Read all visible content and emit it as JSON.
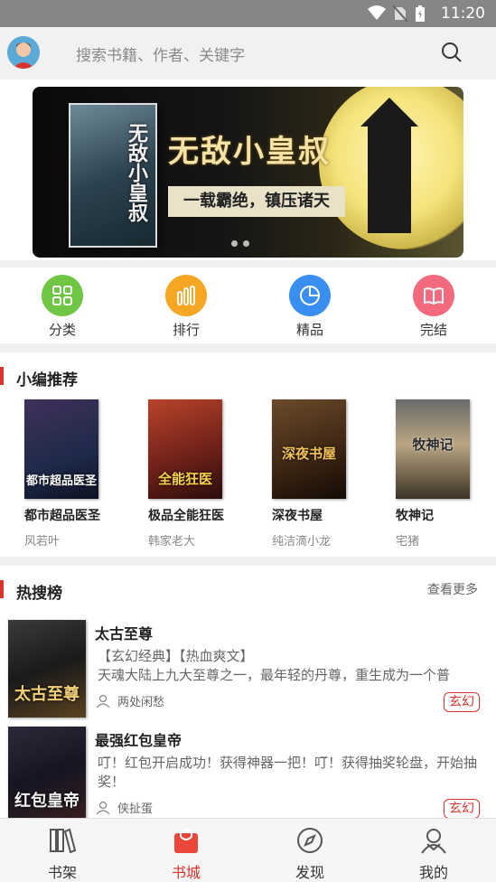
{
  "status_bar": {
    "time": "11:20"
  },
  "search": {
    "placeholder": "搜索书籍、作者、关键字"
  },
  "banner": {
    "title": "无敌小皇叔",
    "subtitle": "一载霸绝，镇压诸天",
    "cover_text": "无敌小皇叔"
  },
  "categories": [
    {
      "label": "分类",
      "color": "#6fc645",
      "icon": "grid-icon"
    },
    {
      "label": "排行",
      "color": "#f5a623",
      "icon": "bars-icon"
    },
    {
      "label": "精品",
      "color": "#3a8ef0",
      "icon": "pie-icon"
    },
    {
      "label": "完结",
      "color": "#f36a7f",
      "icon": "book-icon"
    }
  ],
  "editor_picks": {
    "title": "小编推荐",
    "books": [
      {
        "name": "都市超品医圣",
        "author": "风若叶",
        "cover_text": "都市超品医圣"
      },
      {
        "name": "极品全能狂医",
        "author": "韩家老大",
        "cover_text": "全能狂医"
      },
      {
        "name": "深夜书屋",
        "author": "纯洁滴小龙",
        "cover_text": "深夜书屋"
      },
      {
        "name": "牧神记",
        "author": "宅猪",
        "cover_text": "牧神记"
      }
    ]
  },
  "hot_search": {
    "title": "热搜榜",
    "more": "查看更多",
    "items": [
      {
        "title": "太古至尊",
        "desc": "【玄幻经典】【热血爽文】\n天魂大陆上九大至尊之一，最年轻的丹尊，重生成为一个普",
        "author": "两处闲愁",
        "tag": "玄幻",
        "cover_text": "太古至尊"
      },
      {
        "title": "最强红包皇帝",
        "desc": "叮！红包开启成功！获得神器一把！叮！获得抽奖轮盘，开始抽奖！",
        "author": "侠扯蛋",
        "tag": "玄幻",
        "cover_text": "红包皇帝"
      }
    ]
  },
  "tabbar": {
    "tabs": [
      {
        "label": "书架",
        "icon": "bookshelf-icon"
      },
      {
        "label": "书城",
        "icon": "bookstore-bag-icon",
        "active": true
      },
      {
        "label": "发现",
        "icon": "compass-icon"
      },
      {
        "label": "我的",
        "icon": "profile-icon"
      }
    ]
  },
  "colors": {
    "accent": "#d9332c",
    "active_tab": "#e8473a"
  }
}
